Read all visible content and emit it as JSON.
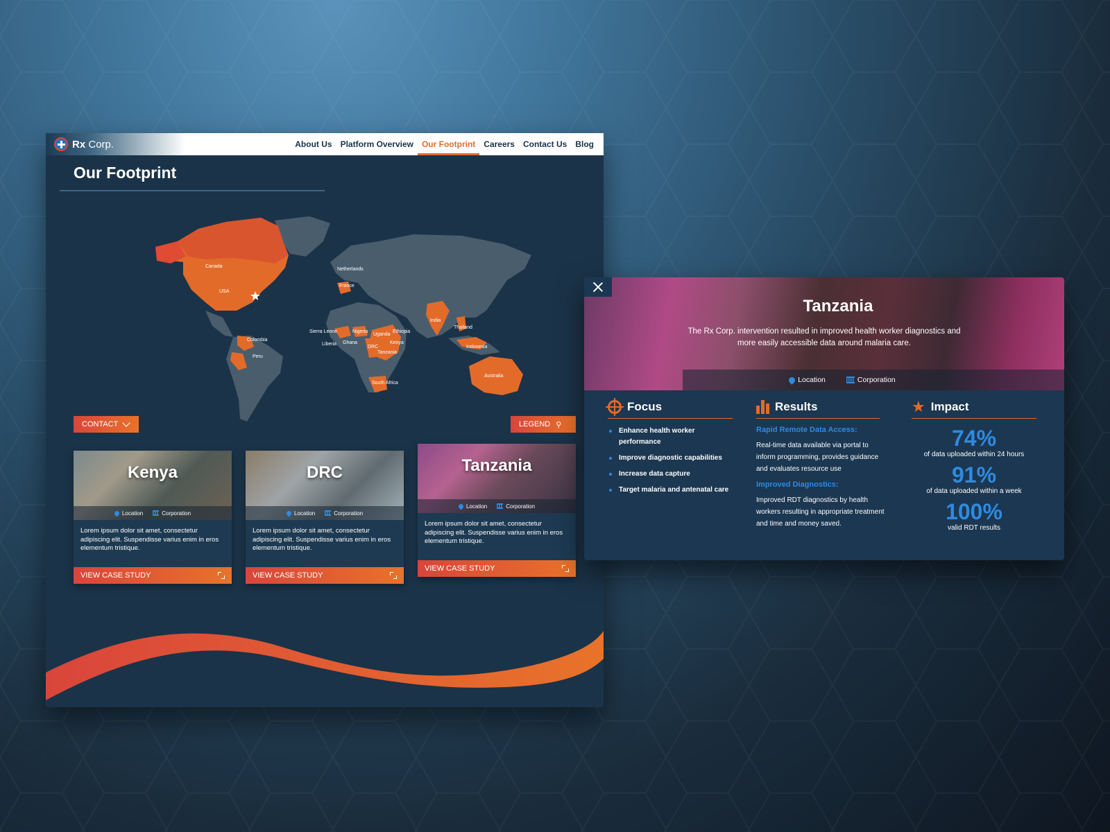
{
  "brand": {
    "name_bold": "Rx",
    "name_thin": "Corp."
  },
  "nav": {
    "items": [
      {
        "label": "About Us"
      },
      {
        "label": "Platform Overview"
      },
      {
        "label": "Our Footprint"
      },
      {
        "label": "Careers"
      },
      {
        "label": "Contact Us"
      },
      {
        "label": "Blog"
      }
    ],
    "active": "Our Footprint"
  },
  "page": {
    "title": "Our Footprint"
  },
  "map": {
    "labels": [
      "Canada",
      "USA",
      "Netherlands",
      "France",
      "Colombia",
      "Peru",
      "Sierra Leone",
      "Liberia",
      "Ghana",
      "Nigeria",
      "Uganda",
      "Ethiopia",
      "Kenya",
      "DRC",
      "Tanzania",
      "South Africa",
      "India",
      "Thailand",
      "Indonesia",
      "Australia"
    ]
  },
  "buttons": {
    "contact": "CONTACT",
    "legend": "LEGEND"
  },
  "cards": [
    {
      "name": "Kenya",
      "location": "Location",
      "corporation": "Corporation",
      "text": "Lorem ipsum dolor sit amet, consectetur adipiscing elit. Suspendisse varius enim in eros elementum tristique.",
      "cta": "VIEW CASE STUDY"
    },
    {
      "name": "DRC",
      "location": "Location",
      "corporation": "Corporation",
      "text": "Lorem ipsum dolor sit amet, consectetur adipiscing elit. Suspendisse varius enim in eros elementum tristique.",
      "cta": "VIEW CASE STUDY"
    },
    {
      "name": "Tanzania",
      "location": "Location",
      "corporation": "Corporation",
      "text": "Lorem ipsum dolor sit amet, consectetur adipiscing elit. Suspendisse varius enim in eros elementum tristique.",
      "cta": "VIEW CASE STUDY"
    }
  ],
  "modal": {
    "title": "Tanzania",
    "subtitle": "The Rx Corp. intervention resulted in improved health worker diagnostics and more easily accessible data around malaria care.",
    "location": "Location",
    "corporation": "Corporation",
    "focus": {
      "heading": "Focus",
      "items": [
        "Enhance health worker performance",
        "Improve diagnostic capabilities",
        "Increase data capture",
        "Target malaria and antenatal care"
      ]
    },
    "results": {
      "heading": "Results",
      "blocks": [
        {
          "title": "Rapid Remote Data Access:",
          "text": "Real-time data available via portal to inform programming, provides guidance and evaluates resource use"
        },
        {
          "title": "Improved Diagnostics:",
          "text": "Improved RDT diagnostics by health workers resulting in appropriate treatment and time and money saved."
        }
      ]
    },
    "impact": {
      "heading": "Impact",
      "stats": [
        {
          "value": "74%",
          "label": "of data uploaded within 24 hours"
        },
        {
          "value": "91%",
          "label": "of data uploaded within a week"
        },
        {
          "value": "100%",
          "label": "valid RDT results"
        }
      ]
    }
  },
  "colors": {
    "accent": "#e36b2a",
    "accent_red": "#d9453b",
    "blue": "#2f8ae0",
    "navy": "#1b3348"
  }
}
